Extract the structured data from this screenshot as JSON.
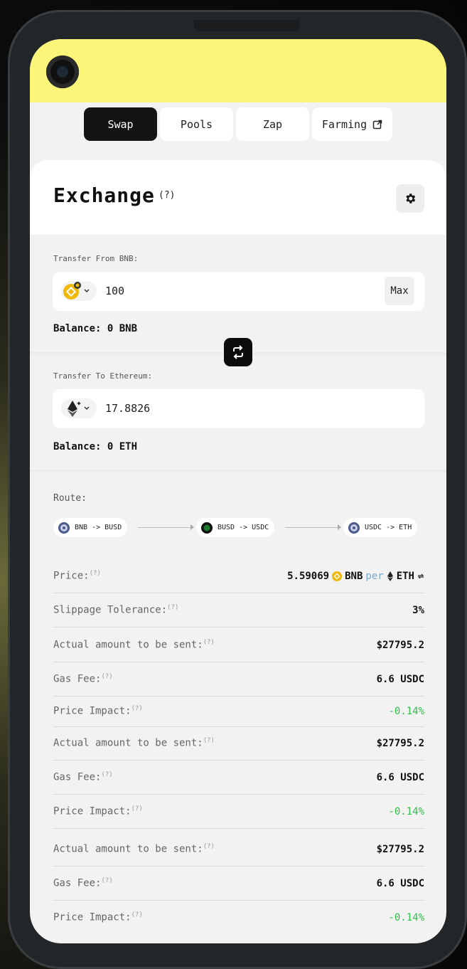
{
  "tabs": [
    {
      "label": "Swap",
      "active": true
    },
    {
      "label": "Pools",
      "active": false
    },
    {
      "label": "Zap",
      "active": false
    },
    {
      "label": "Farming",
      "active": false,
      "external": true
    }
  ],
  "header": {
    "title": "Exchange",
    "help": "(?)"
  },
  "from": {
    "label": "Transfer From BNB:",
    "token_icon": "bnb-icon",
    "amount": "100",
    "max_label": "Max",
    "balance": "Balance: 0 BNB"
  },
  "to": {
    "label": "Transfer To Ethereum:",
    "token_icon": "eth-icon",
    "amount": "17.8826",
    "balance": "Balance: 0 ETH"
  },
  "route": {
    "label": "Route:",
    "steps": [
      "BNB -> BUSD",
      "BUSD -> USDC",
      "USDC -> ETH"
    ]
  },
  "details": {
    "price_label": "Price:",
    "price_value": "5.59069",
    "price_from": "BNB",
    "price_per": "per",
    "price_to": "ETH",
    "slippage_label": "Slippage Tolerance:",
    "slippage_value": "3%",
    "help": "(?)"
  },
  "groups": [
    {
      "actual_label": "Actual amount to be sent:",
      "actual_value": "$27795.2",
      "gas_label": "Gas Fee:",
      "gas_value": "6.6 USDC",
      "impact_label": "Price Impact:",
      "impact_value": "-0.14%"
    },
    {
      "actual_label": "Actual amount to be sent:",
      "actual_value": "$27795.2",
      "gas_label": "Gas Fee:",
      "gas_value": "6.6 USDC",
      "impact_label": "Price Impact:",
      "impact_value": "-0.14%"
    },
    {
      "actual_label": "Actual amount to be sent:",
      "actual_value": "$27795.2",
      "gas_label": "Gas Fee:",
      "gas_value": "6.6 USDC",
      "impact_label": "Price Impact:",
      "impact_value": "-0.14%"
    }
  ],
  "colors": {
    "accent_yellow": "#fbf57a",
    "positive_green": "#2fbf4a",
    "bnb_gold": "#f0b90b"
  }
}
